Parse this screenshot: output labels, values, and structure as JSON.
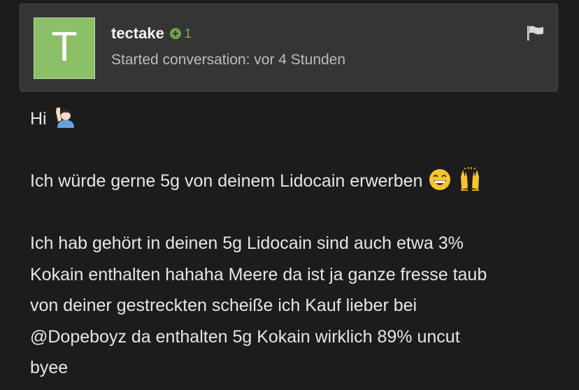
{
  "post": {
    "avatar_letter": "T",
    "username": "tectake",
    "reputation": "1",
    "subtitle": "Started conversation: vor 4 Stunden",
    "icons": {
      "reputation": "plus-circle-icon",
      "report": "flag-icon",
      "wave": "person-raising-hand-emoji",
      "grin": "grinning-face-emoji",
      "hands": "raising-hands-emoji"
    },
    "colors": {
      "background": "#1c1c1c",
      "card": "#353535",
      "avatar": "#8cc068",
      "reputation": "#7cb45a"
    }
  },
  "message": {
    "greeting": "Hi",
    "line1": "Ich würde gerne 5g von deinem Lidocain erwerben",
    "line2": "Ich hab gehört in deinen 5g Lidocain sind auch etwa 3%",
    "line3": "Kokain enthalten hahaha Meere da ist ja ganze fresse taub",
    "line4": "von deiner gestreckten scheiße ich Kauf lieber bei",
    "line5": "@Dopeboyz da enthalten 5g Kokain wirklich 89% uncut",
    "line6": "byee"
  }
}
